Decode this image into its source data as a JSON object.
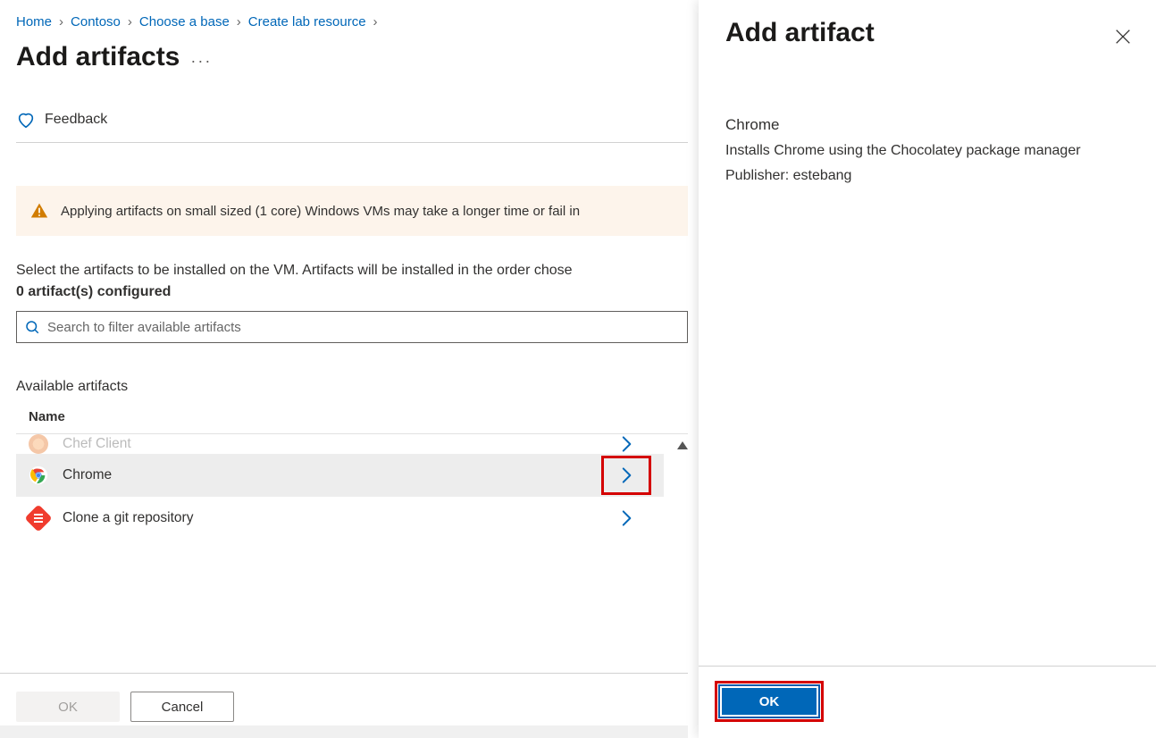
{
  "breadcrumb": {
    "items": [
      {
        "label": "Home"
      },
      {
        "label": "Contoso"
      },
      {
        "label": "Choose a base"
      },
      {
        "label": "Create lab resource"
      }
    ]
  },
  "page": {
    "title": "Add artifacts",
    "feedback_label": "Feedback"
  },
  "warning": {
    "text": "Applying artifacts on small sized (1 core) Windows VMs may take a longer time or fail in"
  },
  "instructions": {
    "line1": "Select the artifacts to be installed on the VM. Artifacts will be installed in the order chose",
    "line2": "0 artifact(s) configured"
  },
  "search": {
    "placeholder": "Search to filter available artifacts"
  },
  "list": {
    "section_label": "Available artifacts",
    "column_header": "Name",
    "rows": [
      {
        "icon": "chef",
        "label": "Chef Client",
        "clipped": true,
        "selected": false
      },
      {
        "icon": "chrome",
        "label": "Chrome",
        "selected": true,
        "highlighted_chevron": true
      },
      {
        "icon": "git",
        "label": "Clone a git repository",
        "selected": false
      }
    ]
  },
  "footer": {
    "ok_label": "OK",
    "cancel_label": "Cancel"
  },
  "panel": {
    "title": "Add artifact",
    "artifact_name": "Chrome",
    "description": "Installs Chrome using the Chocolatey package manager",
    "publisher": "Publisher: estebang",
    "ok_label": "OK"
  }
}
